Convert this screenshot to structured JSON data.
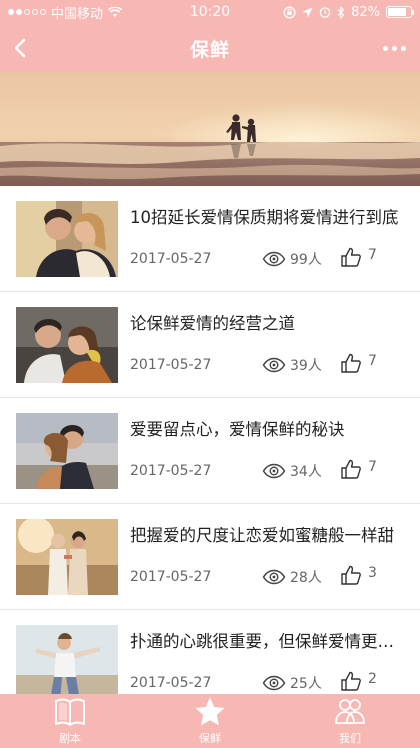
{
  "status_bar": {
    "carrier": "中国移动",
    "time": "10:20",
    "battery": "82%",
    "battery_level": 0.82,
    "signal_dots_filled": 2
  },
  "nav": {
    "title": "保鲜",
    "back_icon": "chevron-left-icon",
    "more_icon": "more-dots-icon"
  },
  "banner": {
    "alt": ""
  },
  "articles": [
    {
      "title": "10招延长爱情保质期将爱情进行到底",
      "date": "2017-05-27",
      "views": "99人",
      "likes": "7"
    },
    {
      "title": "论保鲜爱情的经营之道",
      "date": "2017-05-27",
      "views": "39人",
      "likes": "7"
    },
    {
      "title": "爱要留点心，爱情保鲜的秘诀",
      "date": "2017-05-27",
      "views": "34人",
      "likes": "7"
    },
    {
      "title": "把握爱的尺度让恋爱如蜜糖般一样甜",
      "date": "2017-05-27",
      "views": "28人",
      "likes": "3"
    },
    {
      "title": "扑通的心跳很重要，但保鲜爱情更重要",
      "date": "2017-05-27",
      "views": "25人",
      "likes": "2"
    }
  ],
  "tabs": [
    {
      "label": "剧本",
      "icon": "book-icon"
    },
    {
      "label": "保鲜",
      "icon": "star-icon"
    },
    {
      "label": "我们",
      "icon": "people-icon"
    }
  ],
  "colors": {
    "accent": "#f7b8b4",
    "text": "#222222",
    "meta": "#666666"
  }
}
